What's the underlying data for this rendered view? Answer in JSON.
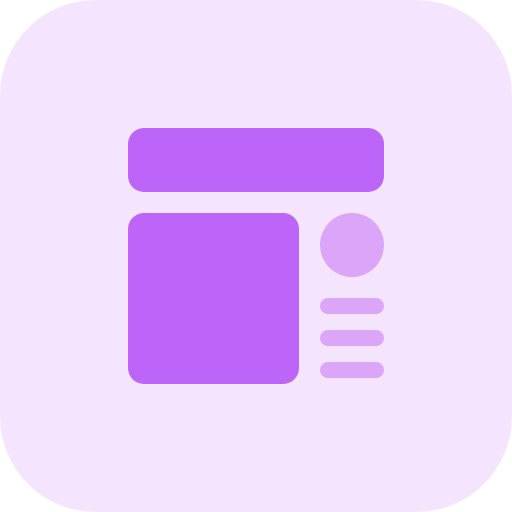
{
  "icon": {
    "name": "layout-dashboard-icon",
    "colors": {
      "background": "#F5E4FD",
      "primary": "#BC65F8",
      "secondary": "#DBA5F8"
    }
  }
}
